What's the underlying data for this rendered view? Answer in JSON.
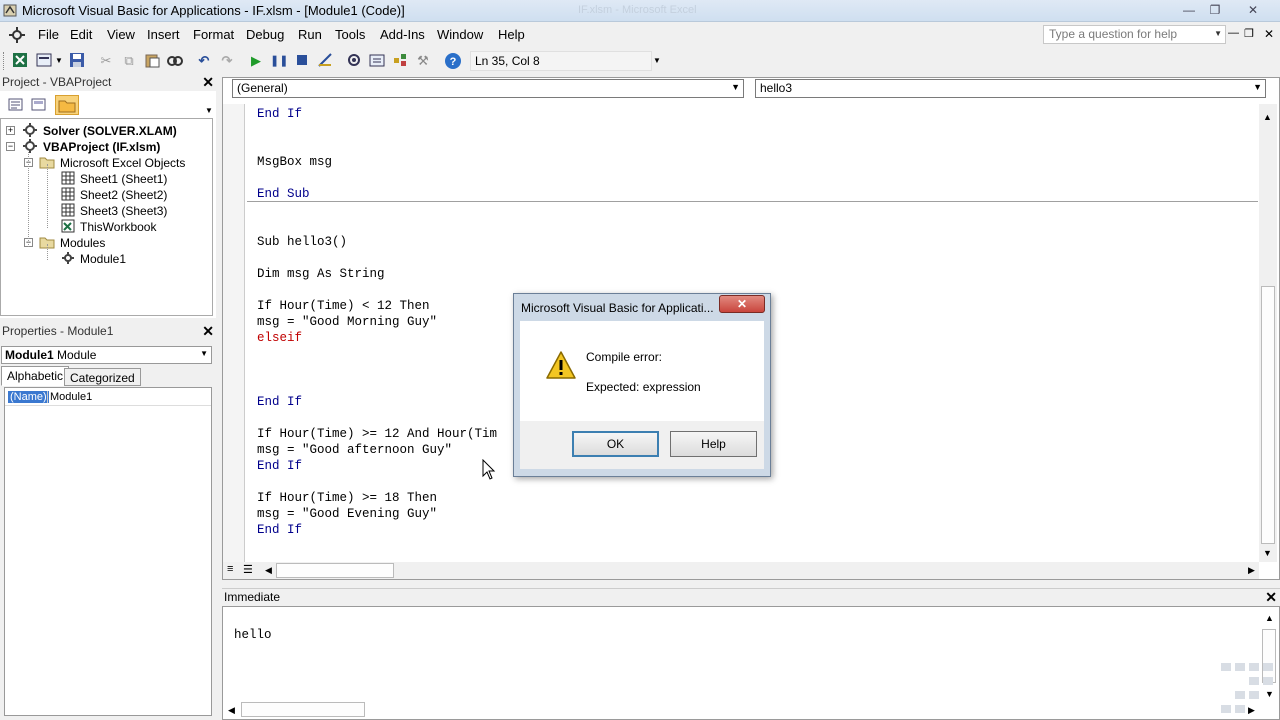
{
  "window": {
    "title": "Microsoft Visual Basic for Applications - IF.xlsm - [Module1 (Code)]",
    "background_title": "IF.xlsm - Microsoft Excel"
  },
  "menu": {
    "items": [
      "File",
      "Edit",
      "View",
      "Insert",
      "Format",
      "Debug",
      "Run",
      "Tools",
      "Add-Ins",
      "Window",
      "Help"
    ],
    "help_placeholder": "Type a question for help"
  },
  "toolbar": {
    "position": "Ln 35, Col 8"
  },
  "project": {
    "title": "Project - VBAProject",
    "tree": [
      {
        "label": "Solver (SOLVER.XLAM)",
        "bold": true
      },
      {
        "label": "VBAProject (IF.xlsm)",
        "bold": true
      },
      {
        "label": "Microsoft Excel Objects"
      },
      {
        "label": "Sheet1 (Sheet1)"
      },
      {
        "label": "Sheet2 (Sheet2)"
      },
      {
        "label": "Sheet3 (Sheet3)"
      },
      {
        "label": "ThisWorkbook"
      },
      {
        "label": "Modules"
      },
      {
        "label": "Module1"
      }
    ]
  },
  "properties": {
    "title": "Properties - Module1",
    "object_name": "Module1",
    "object_type": "Module",
    "tabs": [
      "Alphabetic",
      "Categorized"
    ],
    "row_name": "(Name)",
    "row_value": "Module1"
  },
  "code": {
    "object_combo": "(General)",
    "proc_combo": "hello3",
    "lines": [
      "End If",
      "MsgBox msg",
      "End Sub",
      "Sub hello3()",
      "Dim msg As String",
      "If Hour(Time) < 12 Then",
      "msg = \"Good Morning Guy\"",
      "elseif",
      "End If",
      "If Hour(Time) >= 12 And Hour(Tim",
      "msg = \"Good afternoon Guy\"",
      "End If",
      "If Hour(Time) >= 18 Then",
      "msg = \"Good Evening Guy\"",
      "End If"
    ]
  },
  "immediate": {
    "title": "Immediate",
    "text": "hello"
  },
  "dialog": {
    "title": "Microsoft Visual Basic for Applicati...",
    "heading": "Compile error:",
    "message": "Expected: expression",
    "ok_label": "OK",
    "help_label": "Help"
  },
  "colors": {
    "keyword": "#00008b",
    "error": "#c00000",
    "dialog_frame": "#cdd9e6",
    "close_red": "#c9463d"
  }
}
